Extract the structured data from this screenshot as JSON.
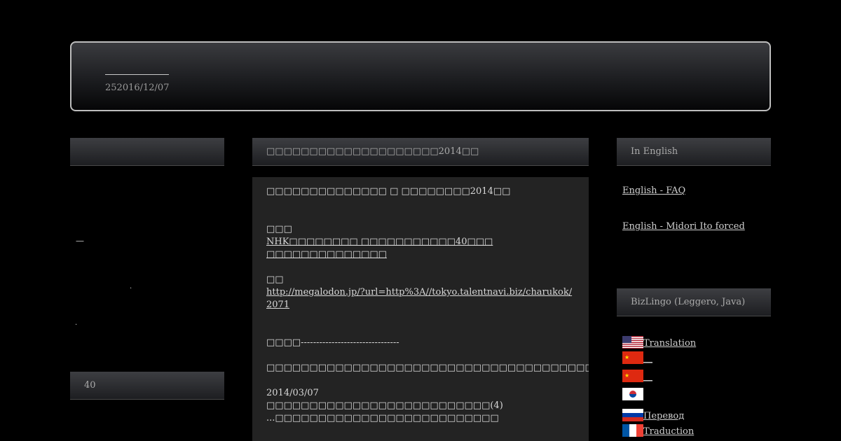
{
  "header": {
    "date": "252016/12/07"
  },
  "left": {
    "bar1_label": "",
    "dash": "—",
    "dot1": ".",
    "dot2": ".",
    "bar2_label": "40"
  },
  "main": {
    "bar_title": "□□□□□□□□□□□□□□□□□□□□2014□□",
    "lines": {
      "l1": "□□□□□□□□□□□□□□ □ □□□□□□□□2014□□",
      "l2": "□□□",
      "l3": "NHK□□□□□□□□ □□□□□□□□□□□40□□□",
      "l4": "□□□□□□□□□□□□□□",
      "l5": "□□",
      "link": "http://megalodon.jp/?url=http%3A//tokyo.talentnavi.biz/charukok/2071",
      "l6": "□□□□--------------------------------",
      "l7": "□□□□□□□□□□□□□□□□□□□□□□□□□□□□□□□□□□□□□□□□□□□□□□□□□□□□",
      "date": "2014/03/07",
      "l8": "□□□□□□□□□□□□□□□□□□□□□□□□□□(4)",
      "l9": "...□□□□□□□□□□□□□□□□□□□□□□□□□□"
    }
  },
  "right": {
    "bar1_label": "In English",
    "links": [
      "English - FAQ",
      "English - Midori Ito forced"
    ],
    "bar2_label": "BizLingo (Leggero, Java)",
    "languages": [
      {
        "flag": "us-flag-icon",
        "label": "Translation"
      },
      {
        "flag": "china-flag-icon",
        "label": "__"
      },
      {
        "flag": "china-flag-icon",
        "label": "__"
      },
      {
        "flag": "korea-flag-icon",
        "label": ""
      },
      {
        "flag": "russia-flag-icon",
        "label": "Перевод"
      },
      {
        "flag": "france-flag-icon",
        "label": "Traduction"
      }
    ]
  }
}
